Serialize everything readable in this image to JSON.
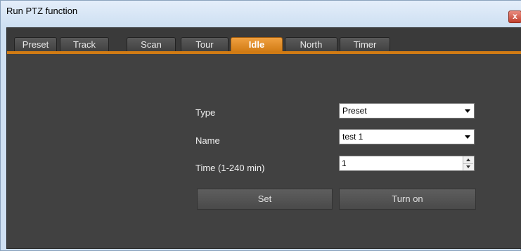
{
  "window": {
    "title": "Run PTZ function",
    "close_label": "x"
  },
  "tabs": [
    {
      "label": "Preset"
    },
    {
      "label": "Track"
    },
    {
      "label": "Scan"
    },
    {
      "label": "Tour"
    },
    {
      "label": "Idle",
      "active": true
    },
    {
      "label": "North"
    },
    {
      "label": "Timer"
    }
  ],
  "form": {
    "type_label": "Type",
    "type_value": "Preset",
    "name_label": "Name",
    "name_value": "test 1",
    "time_label": "Time (1-240 min)",
    "time_value": "1"
  },
  "buttons": {
    "set_label": "Set",
    "turn_on_label": "Turn on"
  },
  "colors": {
    "accent": "#d17b14",
    "panel": "#414141",
    "titlebar": "#cfe0f2"
  }
}
